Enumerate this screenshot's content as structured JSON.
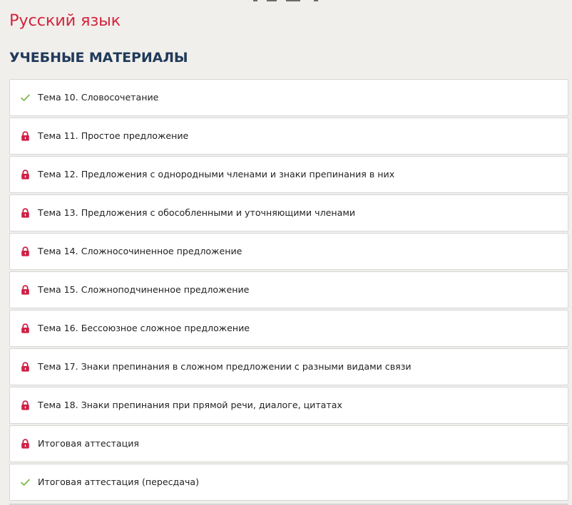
{
  "subject": {
    "title": "Русский язык"
  },
  "section": {
    "title": "УЧЕБНЫЕ МАТЕРИАЛЫ"
  },
  "colors": {
    "accent_red": "#d3263f",
    "heading_navy": "#213a5a",
    "check_green": "#7ab648",
    "lock_red": "#cf1f45"
  },
  "lessons": [
    {
      "label": "Тема 10. Словосочетание",
      "status": "completed",
      "icon": "check-icon"
    },
    {
      "label": "Тема 11. Простое предложение",
      "status": "locked",
      "icon": "lock-icon"
    },
    {
      "label": "Тема 12. Предложения с однородными членами и знаки препинания в них",
      "status": "locked",
      "icon": "lock-icon"
    },
    {
      "label": "Тема 13. Предложения с обособленными и уточняющими членами",
      "status": "locked",
      "icon": "lock-icon"
    },
    {
      "label": "Тема 14. Сложносочиненное предложение",
      "status": "locked",
      "icon": "lock-icon"
    },
    {
      "label": "Тема 15. Сложноподчиненное предложение",
      "status": "locked",
      "icon": "lock-icon"
    },
    {
      "label": "Тема 16. Бессоюзное сложное предложение",
      "status": "locked",
      "icon": "lock-icon"
    },
    {
      "label": "Тема 17. Знаки препинания в сложном предложении с разными видами связи",
      "status": "locked",
      "icon": "lock-icon"
    },
    {
      "label": "Тема 18. Знаки препинания при прямой речи, диалоге, цитатах",
      "status": "locked",
      "icon": "lock-icon"
    },
    {
      "label": "Итоговая аттестация",
      "status": "locked",
      "icon": "lock-icon"
    },
    {
      "label": "Итоговая аттестация (пересдача)",
      "status": "completed",
      "icon": "check-icon"
    }
  ]
}
